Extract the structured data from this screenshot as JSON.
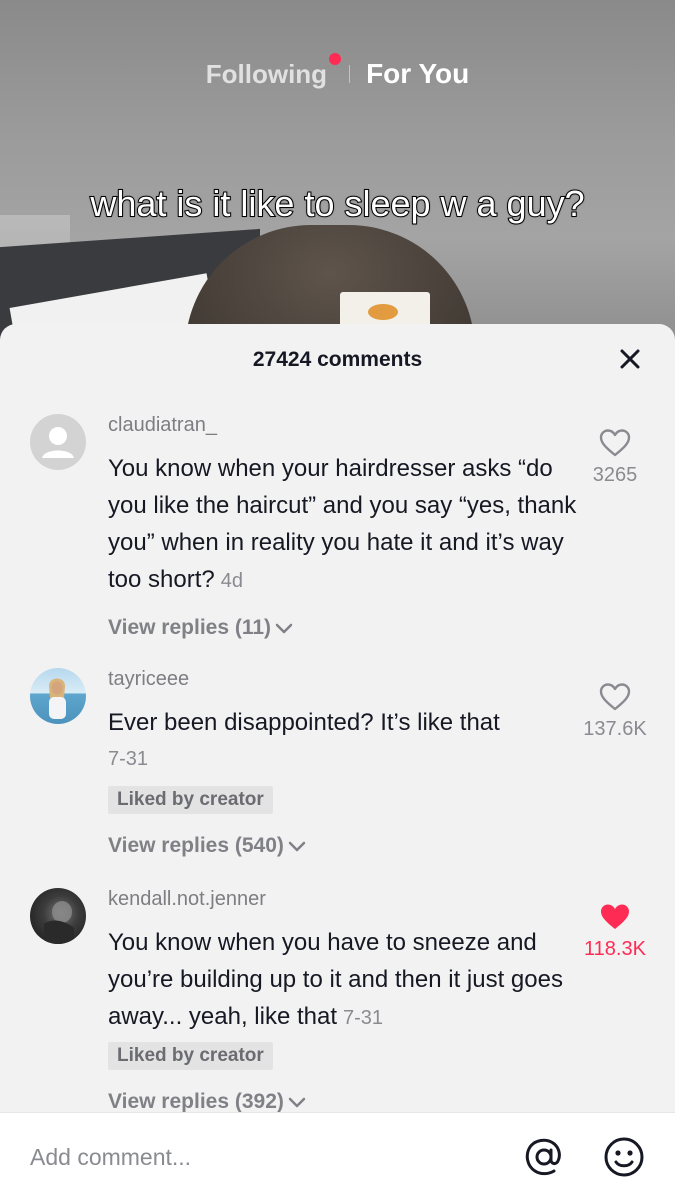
{
  "top_nav": {
    "following_label": "Following",
    "for_you_label": "For You"
  },
  "video": {
    "caption": "what is it like to sleep w a guy?"
  },
  "comments_sheet": {
    "title": "27424 comments",
    "comments": [
      {
        "username": "claudiatran_",
        "text": "You know when your hairdresser asks “do you like the haircut” and you say “yes, thank you” when in reality you hate it and it’s way too short?",
        "timestamp": "4d",
        "likes": "3265",
        "liked": false,
        "view_replies": "View replies (11)"
      },
      {
        "username": "tayriceee",
        "text": "Ever been disappointed? It’s like that",
        "timestamp": "7-31",
        "likes": "137.6K",
        "liked": false,
        "badge": "Liked by creator",
        "view_replies": "View replies (540)"
      },
      {
        "username": "kendall.not.jenner",
        "text": "You know when you have to sneeze and you’re building up to it and then it just goes away... yeah, like that",
        "timestamp": "7-31",
        "likes": "118.3K",
        "liked": true,
        "badge": "Liked by creator",
        "view_replies": "View replies (392)"
      }
    ]
  },
  "input_bar": {
    "placeholder": "Add comment..."
  },
  "colors": {
    "accent": "#fe2c55",
    "text_primary": "#161823",
    "text_secondary": "#8a8b91",
    "sheet_bg": "#f3f2f2"
  },
  "icons": [
    "notification-dot",
    "close-icon",
    "heart-outline-icon",
    "heart-filled-icon",
    "chevron-down-icon",
    "at-mention-icon",
    "emoji-icon",
    "avatar-placeholder-icon"
  ]
}
